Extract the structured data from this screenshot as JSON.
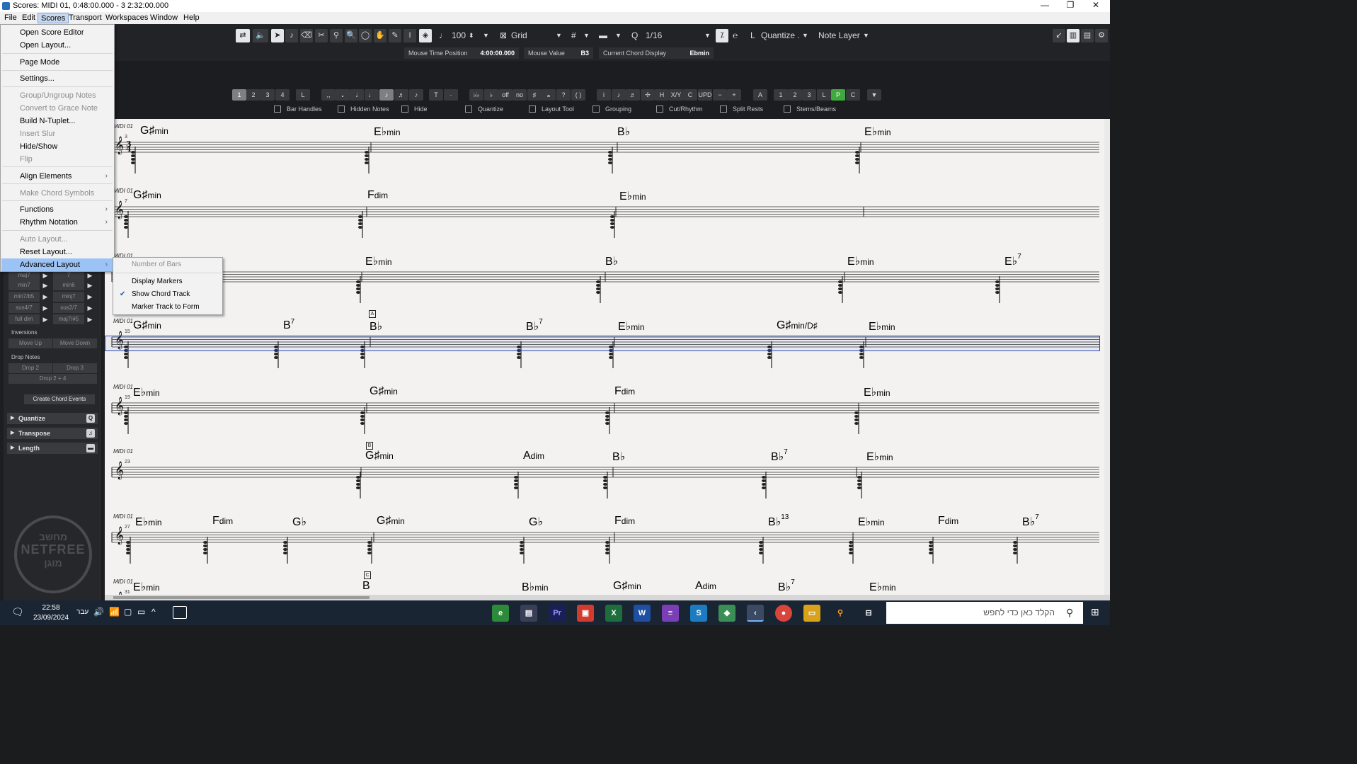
{
  "window": {
    "title": "Scores: MIDI 01, 0:48:00.000 - 3 2:32:00.000",
    "controls": [
      "—",
      "❐",
      "✕"
    ]
  },
  "menubar": [
    "File",
    "Edit",
    "Scores",
    "Transport",
    "Workspaces",
    "Window",
    "Help"
  ],
  "toolbar": {
    "tempo": "100",
    "grid_label": "Grid",
    "quantize_value": "1/16",
    "quantize_label": "Quantize .",
    "layer_label": "Note Layer"
  },
  "info": {
    "mouse_time_label": "Mouse Time Position",
    "mouse_time_value": "4:00:00.000",
    "mouse_value_label": "Mouse Value",
    "mouse_value_value": "B3",
    "chord_label": "Current Chord Display",
    "chord_value": "Ebmin"
  },
  "symbol_tabs": [
    "1",
    "2",
    "3",
    "4",
    "L"
  ],
  "symbol_symbols": [
    ",,",
    "𝅘",
    "𝅗𝅥",
    "♩",
    "♪",
    "♬",
    "♪",
    "𝅘𝅥𝅯"
  ],
  "symbol_text": [
    "T",
    "·"
  ],
  "symbol_acc": [
    "♭♭",
    "♭",
    "off",
    "no",
    "♯",
    "𝄪",
    "?",
    "( )"
  ],
  "symbol_more": [
    "i",
    "♪",
    "♬",
    "✢",
    "H",
    "X/Y",
    "C",
    "UPD",
    "−",
    "+"
  ],
  "symbol_A": "A",
  "symbol_voices": [
    "1",
    "2",
    "3",
    "L",
    "P",
    "C"
  ],
  "symbol_dd": "▼",
  "checkboxes": [
    "Bar Handles",
    "Hidden Notes",
    "Hide",
    "Quantize",
    "Layout Tool",
    "Grouping",
    "Cut/Rhythm",
    "Split Rests",
    "Stems/Beams"
  ],
  "leftpanel": {
    "chord_row1": [
      "maj7",
      "7"
    ],
    "chord_row2": [
      "min7",
      "min6"
    ],
    "chord_row3": [
      "min7/b5",
      "minj7"
    ],
    "chord_row4": [
      "sus4/7",
      "sus2/7"
    ],
    "chord_row5": [
      "full dim",
      "maj7/#5"
    ],
    "inversions": "Inversions",
    "move_up": "Move Up",
    "move_down": "Move Down",
    "drop_notes": "Drop Notes",
    "drop2": "Drop 2",
    "drop3": "Drop 3",
    "drop24": "Drop 2 + 4",
    "create_btn": "Create Chord Events",
    "sections": [
      "Quantize",
      "Transpose",
      "Length"
    ],
    "logo_text": [
      "מחשב",
      "NETFREE",
      "מוגן"
    ]
  },
  "scores_menu": [
    {
      "label": "Open Score Editor",
      "enabled": true
    },
    {
      "label": "Open Layout...",
      "enabled": true
    },
    {
      "label": "Page Mode",
      "enabled": true
    },
    {
      "label": "Settings...",
      "enabled": true
    },
    {
      "label": "Group/Ungroup Notes",
      "enabled": false
    },
    {
      "label": "Convert to Grace Note",
      "enabled": false
    },
    {
      "label": "Build N-Tuplet...",
      "enabled": true
    },
    {
      "label": "Insert Slur",
      "enabled": false
    },
    {
      "label": "Hide/Show",
      "enabled": true
    },
    {
      "label": "Flip",
      "enabled": false
    },
    {
      "label": "Align Elements",
      "enabled": true,
      "sub": true
    },
    {
      "label": "Make Chord Symbols",
      "enabled": false
    },
    {
      "label": "Functions",
      "enabled": true,
      "sub": true
    },
    {
      "label": "Rhythm Notation",
      "enabled": true,
      "sub": true
    },
    {
      "label": "Auto Layout...",
      "enabled": false
    },
    {
      "label": "Reset Layout...",
      "enabled": true
    },
    {
      "label": "Advanced Layout",
      "enabled": true,
      "sub": true,
      "highlighted": true
    }
  ],
  "advanced_submenu": [
    {
      "label": "Number of Bars",
      "enabled": false
    },
    {
      "label": "Display Markers",
      "enabled": true
    },
    {
      "label": "Show Chord Track",
      "enabled": true,
      "checked": true
    },
    {
      "label": "Marker Track to Form",
      "enabled": true
    }
  ],
  "score": {
    "track_name": "MIDI 01",
    "time_sig": "3/4",
    "bars": [
      "3",
      "7",
      "",
      "15",
      "19",
      "23",
      "27",
      "31"
    ],
    "rows": [
      {
        "chords": [
          [
            "G♯",
            "min",
            ""
          ],
          [
            "E♭",
            "min",
            ""
          ],
          [
            "B♭",
            "",
            ""
          ],
          [
            "E♭",
            "min",
            ""
          ]
        ]
      },
      {
        "chords": [
          [
            "G♯",
            "min",
            ""
          ],
          [
            "F",
            "dim",
            ""
          ],
          [
            "E♭",
            "min",
            ""
          ]
        ]
      },
      {
        "chords": [
          [
            "E♭",
            "min",
            ""
          ],
          [
            "B♭",
            "",
            ""
          ],
          [
            "E♭",
            "min",
            ""
          ],
          [
            "E♭",
            "",
            "7"
          ]
        ]
      },
      {
        "chords": [
          [
            "G♯",
            "min",
            ""
          ],
          [
            "B",
            "",
            "7"
          ],
          [
            "B♭",
            "",
            ""
          ],
          [
            "B♭",
            "",
            "7"
          ],
          [
            "E♭",
            "min",
            ""
          ],
          [
            "G♯",
            "min/D♯",
            ""
          ],
          [
            "E♭",
            "min",
            ""
          ]
        ]
      },
      {
        "chords": [
          [
            "E♭",
            "min",
            ""
          ],
          [
            "G♯",
            "min",
            ""
          ],
          [
            "F",
            "dim",
            ""
          ],
          [
            "E♭",
            "min",
            ""
          ]
        ]
      },
      {
        "chords": [
          [
            "G♯",
            "min",
            ""
          ],
          [
            "A",
            "dim",
            ""
          ],
          [
            "B♭",
            "",
            ""
          ],
          [
            "B♭",
            "",
            "7"
          ],
          [
            "E♭",
            "min",
            ""
          ]
        ]
      },
      {
        "chords": [
          [
            "E♭",
            "min",
            ""
          ],
          [
            "F",
            "dim",
            ""
          ],
          [
            "G♭",
            "",
            ""
          ],
          [
            "G♯",
            "min",
            ""
          ],
          [
            "G♭",
            "",
            ""
          ],
          [
            "F",
            "dim",
            ""
          ],
          [
            "B♭",
            "",
            "13"
          ],
          [
            "E♭",
            "min",
            ""
          ],
          [
            "F",
            "dim",
            ""
          ],
          [
            "B♭",
            "",
            "7"
          ]
        ]
      },
      {
        "chords": [
          [
            "E♭",
            "min",
            ""
          ],
          [
            "B",
            "",
            ""
          ],
          [
            "B♭",
            "min",
            ""
          ],
          [
            "G♯",
            "min",
            ""
          ],
          [
            "A",
            "dim",
            ""
          ],
          [
            "B♭",
            "",
            "7"
          ],
          [
            "E♭",
            "min",
            ""
          ]
        ]
      }
    ],
    "rehearsal": [
      "A",
      "B",
      "C"
    ]
  },
  "taskbar": {
    "time": "22:58",
    "date": "23/09/2024",
    "lang": "עבר",
    "search_placeholder": "הקלד כאן כדי לחפש"
  },
  "colors": {
    "accent": "#9cc3f5",
    "highlight_track": "#2c4ab8",
    "green_voice": "#3eaa3e"
  }
}
